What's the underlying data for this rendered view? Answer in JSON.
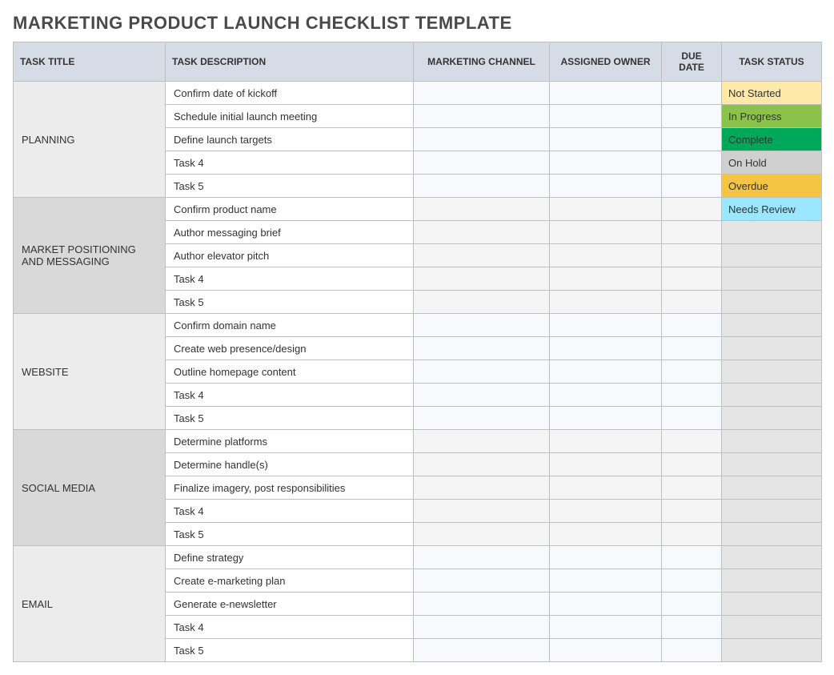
{
  "title": "MARKETING PRODUCT LAUNCH CHECKLIST TEMPLATE",
  "columns": {
    "task_title": "TASK TITLE",
    "task_description": "TASK DESCRIPTION",
    "marketing_channel": "MARKETING CHANNEL",
    "assigned_owner": "ASSIGNED OWNER",
    "due_date": "DUE DATE",
    "task_status": "TASK STATUS"
  },
  "status_styles": {
    "Not Started": "s-not-started",
    "In Progress": "s-in-progress",
    "Complete": "s-complete",
    "On Hold": "s-on-hold",
    "Overdue": "s-overdue",
    "Needs Review": "s-needs-review"
  },
  "sections": [
    {
      "name": "PLANNING",
      "alt": false,
      "rows": [
        {
          "desc": "Confirm date of kickoff",
          "channel": "",
          "owner": "",
          "due": "",
          "status": "Not Started"
        },
        {
          "desc": "Schedule initial launch meeting",
          "channel": "",
          "owner": "",
          "due": "",
          "status": "In Progress"
        },
        {
          "desc": "Define launch targets",
          "channel": "",
          "owner": "",
          "due": "",
          "status": "Complete"
        },
        {
          "desc": "Task 4",
          "channel": "",
          "owner": "",
          "due": "",
          "status": "On Hold"
        },
        {
          "desc": "Task 5",
          "channel": "",
          "owner": "",
          "due": "",
          "status": "Overdue"
        }
      ]
    },
    {
      "name": "MARKET POSITIONING AND MESSAGING",
      "alt": true,
      "rows": [
        {
          "desc": "Confirm product name",
          "channel": "",
          "owner": "",
          "due": "",
          "status": "Needs Review"
        },
        {
          "desc": "Author messaging brief",
          "channel": "",
          "owner": "",
          "due": "",
          "status": ""
        },
        {
          "desc": "Author elevator pitch",
          "channel": "",
          "owner": "",
          "due": "",
          "status": ""
        },
        {
          "desc": "Task 4",
          "channel": "",
          "owner": "",
          "due": "",
          "status": ""
        },
        {
          "desc": "Task 5",
          "channel": "",
          "owner": "",
          "due": "",
          "status": ""
        }
      ]
    },
    {
      "name": "WEBSITE",
      "alt": false,
      "rows": [
        {
          "desc": "Confirm domain name",
          "channel": "",
          "owner": "",
          "due": "",
          "status": ""
        },
        {
          "desc": "Create web presence/design",
          "channel": "",
          "owner": "",
          "due": "",
          "status": ""
        },
        {
          "desc": "Outline homepage content",
          "channel": "",
          "owner": "",
          "due": "",
          "status": ""
        },
        {
          "desc": "Task 4",
          "channel": "",
          "owner": "",
          "due": "",
          "status": ""
        },
        {
          "desc": "Task 5",
          "channel": "",
          "owner": "",
          "due": "",
          "status": ""
        }
      ]
    },
    {
      "name": "SOCIAL MEDIA",
      "alt": true,
      "rows": [
        {
          "desc": "Determine platforms",
          "channel": "",
          "owner": "",
          "due": "",
          "status": ""
        },
        {
          "desc": "Determine handle(s)",
          "channel": "",
          "owner": "",
          "due": "",
          "status": ""
        },
        {
          "desc": "Finalize imagery, post responsibilities",
          "channel": "",
          "owner": "",
          "due": "",
          "status": ""
        },
        {
          "desc": "Task 4",
          "channel": "",
          "owner": "",
          "due": "",
          "status": ""
        },
        {
          "desc": "Task 5",
          "channel": "",
          "owner": "",
          "due": "",
          "status": ""
        }
      ]
    },
    {
      "name": "EMAIL",
      "alt": false,
      "rows": [
        {
          "desc": "Define strategy",
          "channel": "",
          "owner": "",
          "due": "",
          "status": ""
        },
        {
          "desc": "Create e-marketing plan",
          "channel": "",
          "owner": "",
          "due": "",
          "status": ""
        },
        {
          "desc": "Generate e-newsletter",
          "channel": "",
          "owner": "",
          "due": "",
          "status": ""
        },
        {
          "desc": "Task 4",
          "channel": "",
          "owner": "",
          "due": "",
          "status": ""
        },
        {
          "desc": "Task 5",
          "channel": "",
          "owner": "",
          "due": "",
          "status": ""
        }
      ]
    }
  ]
}
